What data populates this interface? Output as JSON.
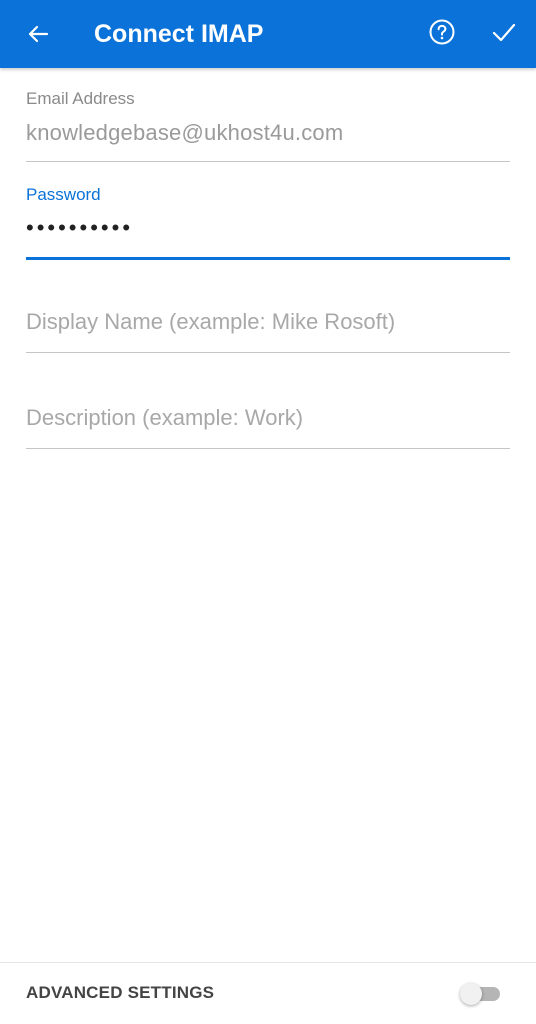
{
  "header": {
    "title": "Connect IMAP",
    "back_icon": "arrow-left-icon",
    "help_icon": "question-circle-icon",
    "confirm_icon": "checkmark-icon",
    "background_color": "#0a72d8"
  },
  "form": {
    "email": {
      "label": "Email Address",
      "value": "knowledgebase@ukhost4u.com"
    },
    "password": {
      "label": "Password",
      "value": "••••••••••"
    },
    "display_name": {
      "placeholder": "Display Name (example: Mike Rosoft)"
    },
    "description": {
      "placeholder": "Description (example: Work)"
    }
  },
  "advanced": {
    "label": "ADVANCED SETTINGS",
    "toggle_on": false
  },
  "colors": {
    "accent": "#0a72d8"
  }
}
